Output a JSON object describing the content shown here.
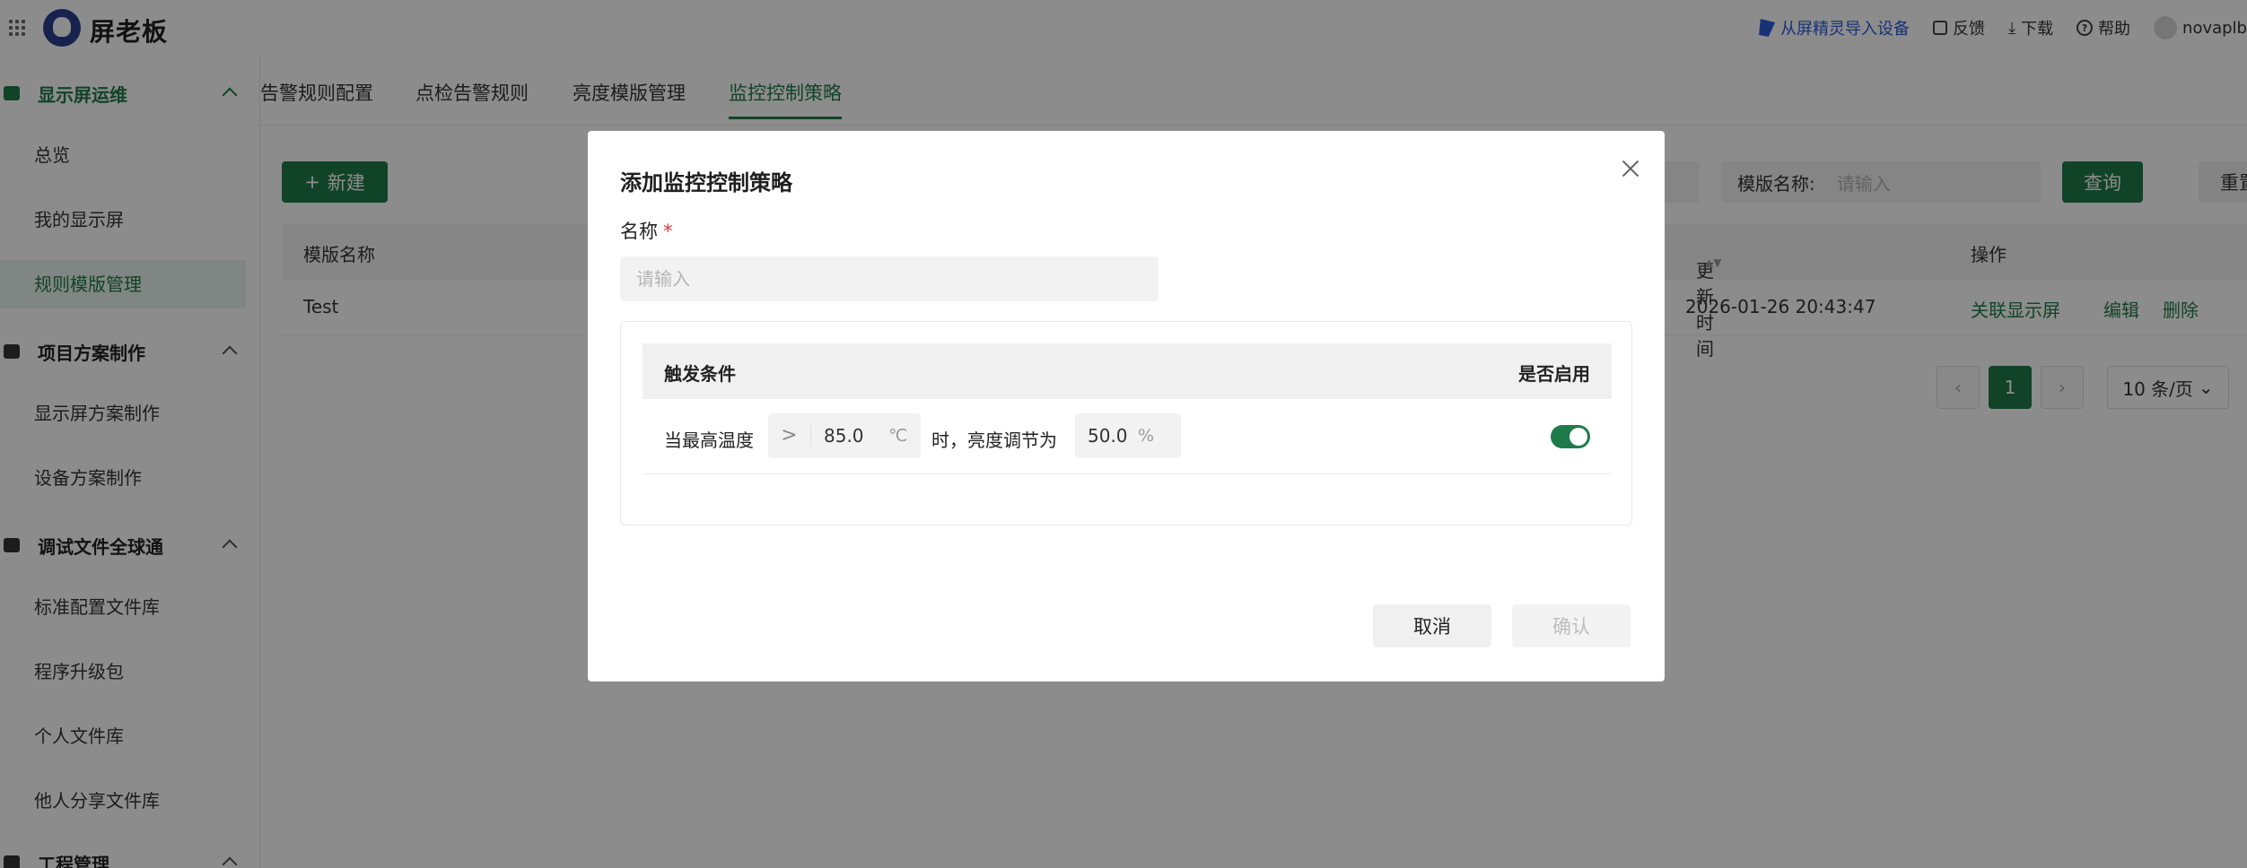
{
  "app": {
    "brand": "屏老板",
    "logo_icon": "wallet-logo-icon"
  },
  "topbar": {
    "import_label": "从屏精灵导入设备",
    "feedback_label": "反馈",
    "download_label": "下载",
    "help_label": "帮助",
    "user_name": "novaplb"
  },
  "sidebar": {
    "groups": [
      {
        "label": "显示屏运维",
        "icon": "chart-icon"
      },
      {
        "label": "项目方案制作",
        "icon": "briefcase-icon"
      },
      {
        "label": "调试文件全球通",
        "icon": "file-icon"
      },
      {
        "label": "工程管理",
        "icon": "project-icon"
      }
    ],
    "items": [
      {
        "label": "总览"
      },
      {
        "label": "我的显示屏"
      },
      {
        "label": "规则模版管理"
      },
      {
        "label": "显示屏方案制作"
      },
      {
        "label": "设备方案制作"
      },
      {
        "label": "标准配置文件库"
      },
      {
        "label": "程序升级包"
      },
      {
        "label": "个人文件库"
      },
      {
        "label": "他人分享文件库"
      }
    ]
  },
  "tabs": [
    {
      "label": "告警规则配置"
    },
    {
      "label": "点检告警规则"
    },
    {
      "label": "亮度模版管理"
    },
    {
      "label": "监控控制策略"
    }
  ],
  "toolbar": {
    "new_label": "新建",
    "filter_label": "模版名称:",
    "filter_placeholder": "请输入",
    "query_label": "查询",
    "reset_label": "重置"
  },
  "table": {
    "headers": {
      "name": "模版名称",
      "updated": "更新时间",
      "actions": "操作"
    },
    "rows": [
      {
        "name": "Test",
        "updated": "2026-01-26 20:43:47",
        "action_link": "关联显示屏",
        "action_edit": "编辑",
        "action_delete": "删除"
      }
    ]
  },
  "pagination": {
    "current_page": "1",
    "page_size": "10 条/页"
  },
  "modal": {
    "title": "添加监控控制策略",
    "name_label": "名称",
    "required_mark": "*",
    "name_placeholder": "请输入",
    "name_value": "",
    "panel": {
      "header_condition": "触发条件",
      "header_enabled": "是否启用",
      "row": {
        "prefix": "当最高温度",
        "operator": ">",
        "temp_value": "85.0",
        "temp_unit": "℃",
        "middle": "时，亮度调节为",
        "brightness_value": "50.0",
        "brightness_unit": "%",
        "enabled": true
      }
    },
    "cancel_label": "取消",
    "confirm_label": "确认"
  },
  "colors": {
    "accent": "#1f7a4a",
    "link_blue": "#2a5bd7",
    "required_red": "#d9363e",
    "overlay": "rgba(0,0,0,0.45)"
  }
}
